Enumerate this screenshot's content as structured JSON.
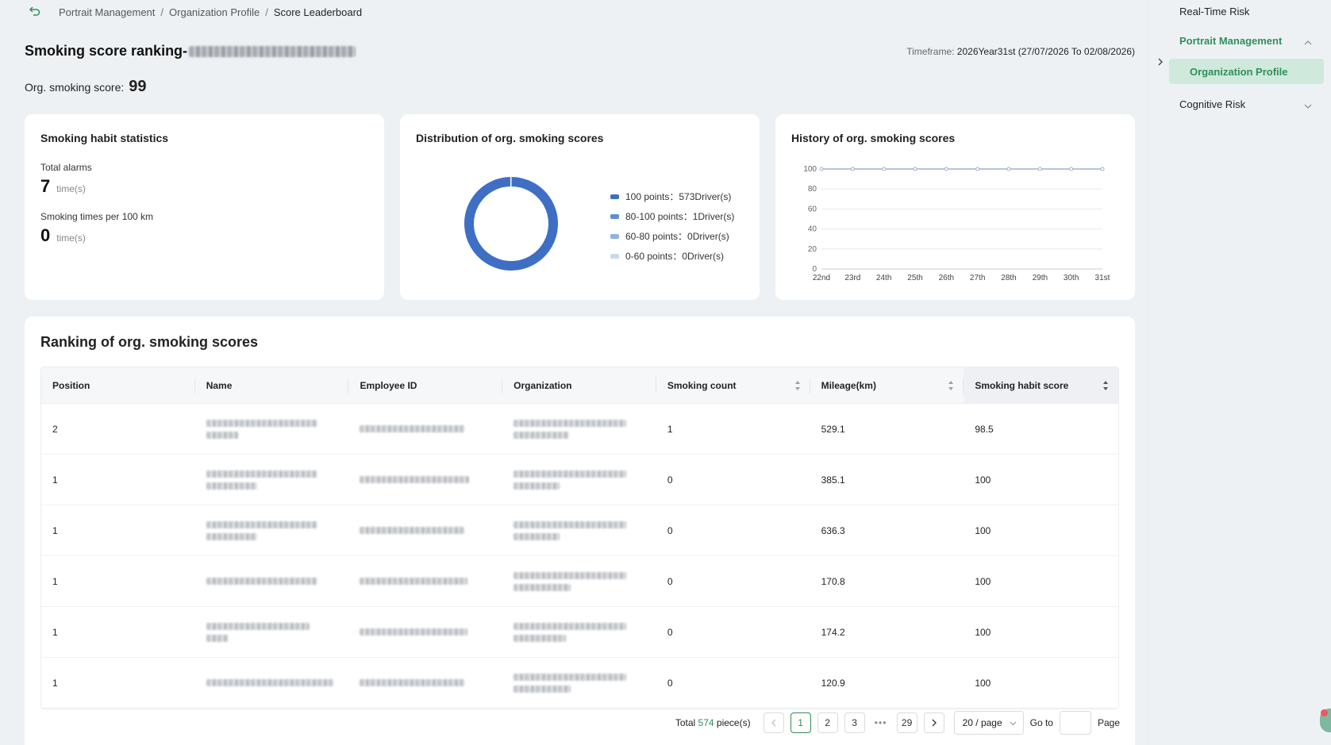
{
  "breadcrumb": {
    "items": [
      "Portrait Management",
      "Organization Profile",
      "Score Leaderboard"
    ],
    "separator": "/"
  },
  "page": {
    "title_prefix": "Smoking score ranking-",
    "timeframe_label": "Timeframe:",
    "timeframe_value": "2026Year31st (27/07/2026 To 02/08/2026)",
    "org_score_label": "Org. smoking score:",
    "org_score_value": "99"
  },
  "habit_stats": {
    "title": "Smoking habit statistics",
    "total_alarms_label": "Total alarms",
    "total_alarms_value": "7",
    "total_alarms_unit": "time(s)",
    "per100_label": "Smoking times per 100 km",
    "per100_value": "0",
    "per100_unit": "time(s)"
  },
  "distribution": {
    "title": "Distribution of org. smoking scores",
    "colors": [
      "#3f6fc4",
      "#5d8fd8",
      "#90b2e4",
      "#c9d9ef"
    ],
    "legend": [
      "100 points：573Driver(s)",
      "80-100 points：1Driver(s)",
      "60-80 points：0Driver(s)",
      "0-60 points：0Driver(s)"
    ],
    "counts": [
      573,
      1,
      0,
      0
    ]
  },
  "history": {
    "title": "History of org. smoking scores",
    "color": "#9ab3d3"
  },
  "chart_data": {
    "type": "line",
    "x": [
      "22nd",
      "23rd",
      "24th",
      "25th",
      "26th",
      "27th",
      "28th",
      "29th",
      "30th",
      "31st"
    ],
    "series": [
      {
        "values": [
          100,
          100,
          100,
          100,
          100,
          100,
          100,
          100,
          100,
          100
        ]
      }
    ],
    "yticks": [
      0,
      20,
      40,
      60,
      80,
      100
    ],
    "ylim": [
      0,
      100
    ],
    "grid": true
  },
  "ranking": {
    "title": "Ranking of org. smoking scores",
    "columns": [
      "Position",
      "Name",
      "Employee ID",
      "Organization",
      "Smoking count",
      "Mileage(km)",
      "Smoking habit score"
    ],
    "rows": [
      {
        "position": "2",
        "count": "1",
        "mileage": "529.1",
        "score": "98.5"
      },
      {
        "position": "1",
        "count": "0",
        "mileage": "385.1",
        "score": "100"
      },
      {
        "position": "1",
        "count": "0",
        "mileage": "636.3",
        "score": "100"
      },
      {
        "position": "1",
        "count": "0",
        "mileage": "170.8",
        "score": "100"
      },
      {
        "position": "1",
        "count": "0",
        "mileage": "174.2",
        "score": "100"
      },
      {
        "position": "1",
        "count": "0",
        "mileage": "120.9",
        "score": "100"
      }
    ]
  },
  "pagination": {
    "total_prefix": "Total",
    "total": "574",
    "total_suffix": "piece(s)",
    "pages": [
      "1",
      "2",
      "3"
    ],
    "last_page": "29",
    "page_size": "20 / page",
    "goto_label": "Go to",
    "page_label": "Page",
    "current": "1"
  },
  "sidebar": {
    "items": [
      "Real-Time Risk",
      "Portrait Management",
      "Organization Profile",
      "Cognitive Risk"
    ]
  },
  "accent": "#2f8f5a"
}
